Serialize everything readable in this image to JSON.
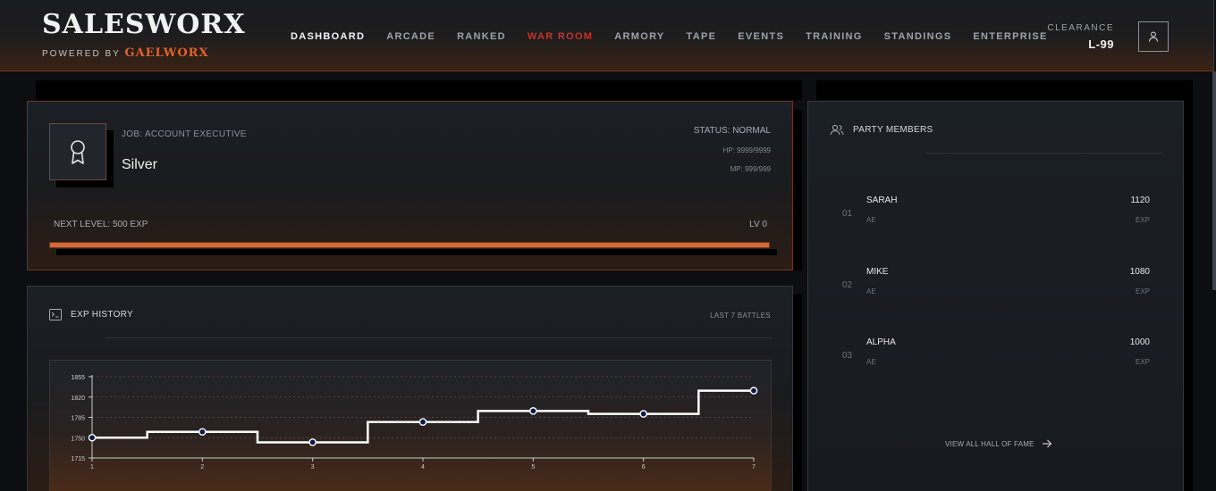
{
  "brand": {
    "name": "SALESWORX",
    "powered_by": "POWERED BY",
    "partner": "GAELWORX"
  },
  "nav": {
    "items": [
      {
        "label": "DASHBOARD",
        "state": "active"
      },
      {
        "label": "ARCADE",
        "state": ""
      },
      {
        "label": "RANKED",
        "state": ""
      },
      {
        "label": "WAR ROOM",
        "state": "highlight"
      },
      {
        "label": "ARMORY",
        "state": ""
      },
      {
        "label": "TAPE",
        "state": ""
      },
      {
        "label": "EVENTS",
        "state": ""
      },
      {
        "label": "TRAINING",
        "state": ""
      },
      {
        "label": "STANDINGS",
        "state": ""
      },
      {
        "label": "ENTERPRISE",
        "state": ""
      }
    ]
  },
  "clearance": {
    "label": "CLEARANCE",
    "value": "L-99"
  },
  "profile": {
    "job": "JOB: ACCOUNT EXECUTIVE",
    "rank": "Silver",
    "status": "STATUS: NORMAL",
    "hp": "HP: 9999/9999",
    "mp": "MP: 999/999",
    "next_level": "NEXT LEVEL: 500 EXP",
    "level": "LV 0",
    "progress": 1.0,
    "badge_icon": "award-ribbon-icon"
  },
  "exp_history": {
    "title": "EXP HISTORY",
    "range": "LAST 7 BATTLES",
    "icon": "terminal-icon"
  },
  "chart_data": {
    "type": "line",
    "step": true,
    "x": [
      1,
      2,
      3,
      4,
      5,
      6,
      7
    ],
    "values": [
      1750,
      1760,
      1742,
      1777,
      1796,
      1791,
      1831
    ],
    "ylim": [
      1715,
      1855
    ],
    "yticks": [
      1715,
      1750,
      1785,
      1820,
      1855
    ],
    "xticks": [
      1,
      2,
      3,
      4,
      5,
      6,
      7
    ],
    "grid": "dashed horizontal",
    "line_color": "#ffffff",
    "point_color": "#0d1b4a"
  },
  "party": {
    "title": "PARTY MEMBERS",
    "icon": "users-icon",
    "members": [
      {
        "rank": "01",
        "name": "SARAH",
        "role": "AE",
        "score": "1120",
        "unit": "EXP"
      },
      {
        "rank": "02",
        "name": "MIKE",
        "role": "AE",
        "score": "1080",
        "unit": "EXP"
      },
      {
        "rank": "03",
        "name": "ALPHA",
        "role": "AE",
        "score": "1000",
        "unit": "EXP"
      }
    ],
    "view_all": "VIEW ALL HALL OF FAME"
  },
  "colors": {
    "accent": "#d36a35",
    "war_room": "#c7322c",
    "panel_border": "#6d341c"
  }
}
